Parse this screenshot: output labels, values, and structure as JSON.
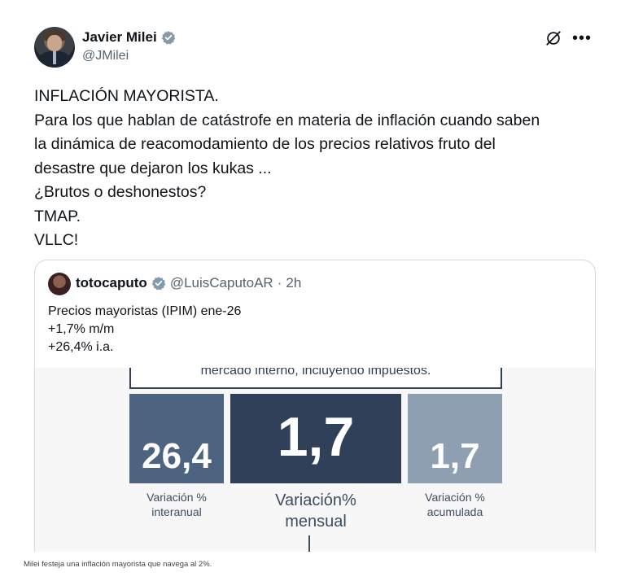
{
  "author": {
    "name": "Javier Milei",
    "handle": "@JMilei",
    "verified": true
  },
  "tweet_lines": [
    "INFLACIÓN MAYORISTA.",
    "Para los que hablan de catástrofe en materia de inflación cuando saben",
    "la dinámica de reacomodamiento de los precios relativos fruto del",
    "desastre que dejaron los kukas ...",
    "¿Brutos o deshonestos?",
    "TMAP.",
    "VLLC!"
  ],
  "quote": {
    "name": "totocaputo",
    "handle": "@LuisCaputoAR",
    "separator": "·",
    "time": "2h",
    "lines": [
      "Precios mayoristas (IPIM) ene-26",
      "+1,7% m/m",
      "+26,4% i.a."
    ]
  },
  "infographic": {
    "banner_text": "mercado interno, incluyendo impuestos.",
    "boxes": [
      {
        "value": "26,4",
        "caption_line1": "Variación %",
        "caption_line2": "interanual",
        "color": "#4d6480"
      },
      {
        "value": "1,7",
        "caption_line1": "Variación%",
        "caption_line2": "mensual",
        "color": "#2f4058"
      },
      {
        "value": "1,7",
        "caption_line1": "Variación %",
        "caption_line2": "acumulada",
        "color": "#8f9fb2"
      }
    ]
  },
  "icons": {
    "verified": "verified-badge-icon",
    "grok": "grok-icon",
    "more": "more-options-icon"
  },
  "colors": {
    "verified_badge": "#829aab",
    "text": "#0f1419",
    "muted": "#536471",
    "border": "#cfd9de"
  },
  "caption": "Milei festeja una inflación mayorista que navega al 2%."
}
